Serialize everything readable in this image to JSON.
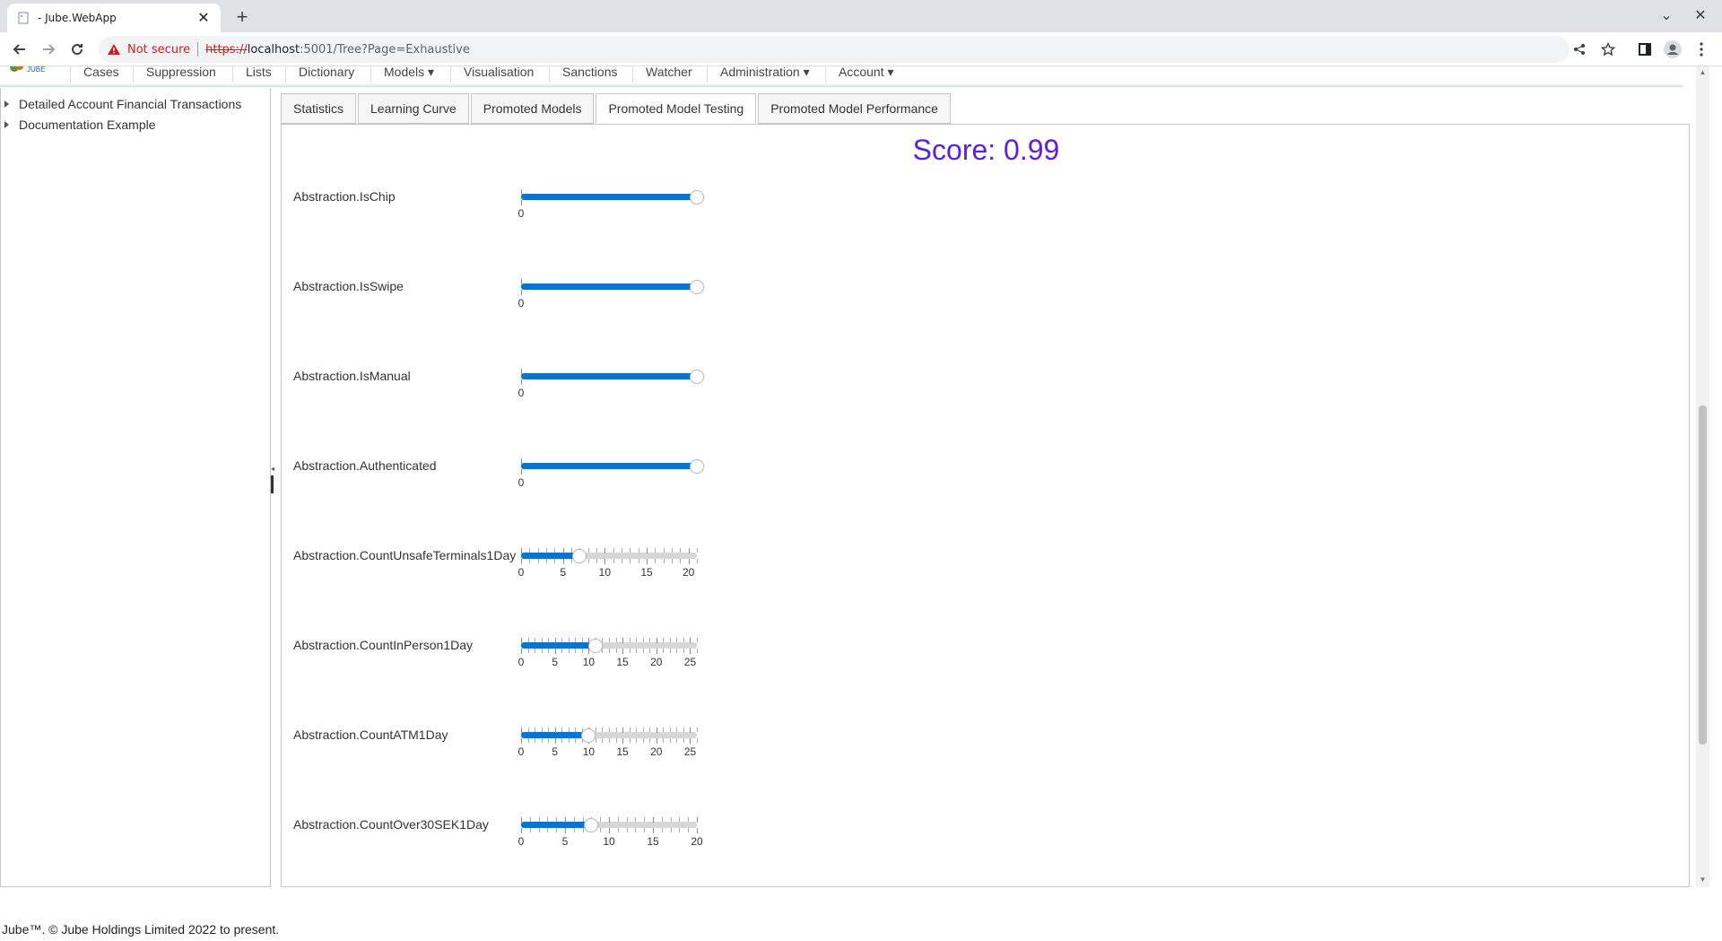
{
  "browser": {
    "tab_title": "- Jube.WebApp",
    "not_secure_label": "Not secure",
    "url_scheme": "https://",
    "url_host": "localhost",
    "url_rest": ":5001/Tree?Page=Exhaustive"
  },
  "app_menu": {
    "items": [
      "Cases",
      "Suppression",
      "Lists",
      "Dictionary",
      "Models ▾",
      "Visualisation",
      "Sanctions",
      "Watcher",
      "Administration ▾",
      "Account ▾"
    ]
  },
  "tree": {
    "items": [
      "Detailed Account Financial Transactions",
      "Documentation Example"
    ]
  },
  "tabs": [
    "Statistics",
    "Learning Curve",
    "Promoted Models",
    "Promoted Model Testing",
    "Promoted Model Performance"
  ],
  "active_tab": "Promoted Model Testing",
  "score_text": "Score: 0.99",
  "fields": [
    {
      "label": "Abstraction.IsChip",
      "value": 1,
      "max": 1,
      "ticks": [
        "0"
      ]
    },
    {
      "label": "Abstraction.IsSwipe",
      "value": 1,
      "max": 1,
      "ticks": [
        "0"
      ]
    },
    {
      "label": "Abstraction.IsManual",
      "value": 1,
      "max": 1,
      "ticks": [
        "0"
      ]
    },
    {
      "label": "Abstraction.Authenticated",
      "value": 1,
      "max": 1,
      "ticks": [
        "0"
      ]
    },
    {
      "label": "Abstraction.CountUnsafeTerminals1Day",
      "value": 7,
      "max": 21,
      "ticks": [
        "0",
        "5",
        "10",
        "15",
        "20"
      ]
    },
    {
      "label": "Abstraction.CountInPerson1Day",
      "value": 11,
      "max": 26,
      "ticks": [
        "0",
        "5",
        "10",
        "15",
        "20",
        "25"
      ]
    },
    {
      "label": "Abstraction.CountATM1Day",
      "value": 10,
      "max": 26,
      "ticks": [
        "0",
        "5",
        "10",
        "15",
        "20",
        "25"
      ]
    },
    {
      "label": "Abstraction.CountOver30SEK1Day",
      "value": 8,
      "max": 20,
      "ticks": [
        "0",
        "5",
        "10",
        "15",
        "20"
      ]
    }
  ],
  "footer_text": "Jube™. © Jube Holdings Limited 2022 to present.",
  "colors": {
    "accent": "#0a74cf",
    "score": "#5b1fe0"
  }
}
